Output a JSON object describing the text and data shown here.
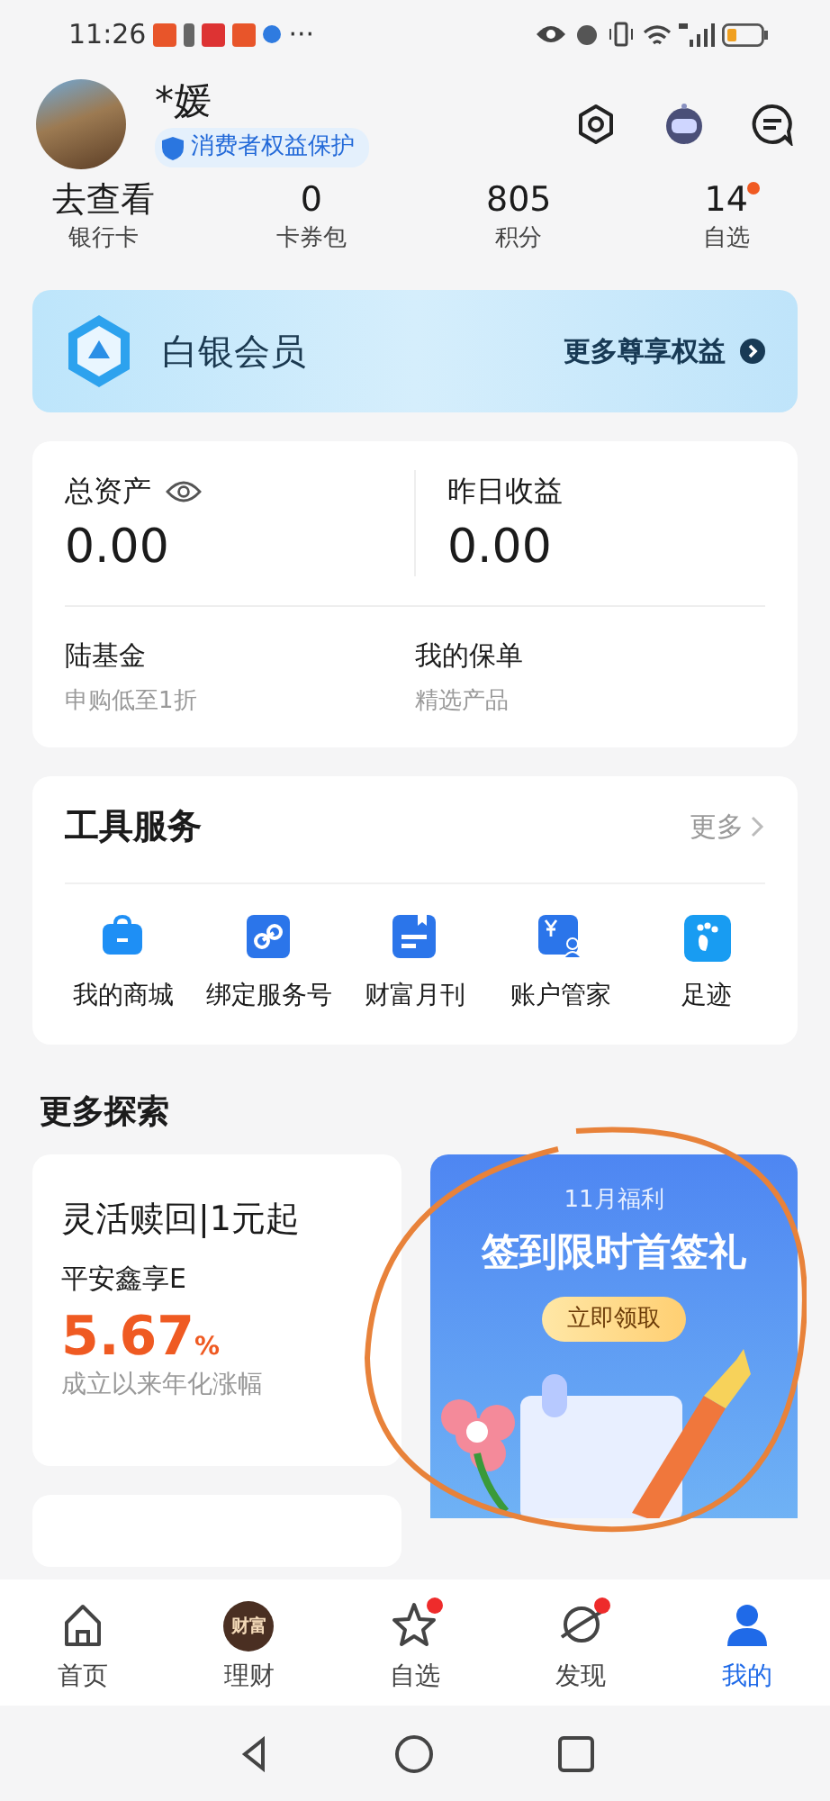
{
  "status_bar": {
    "time": "11:26",
    "more": "···"
  },
  "profile": {
    "name": "*媛",
    "badge": "消费者权益保护"
  },
  "stats": [
    {
      "value": "去查看",
      "label": "银行卡",
      "dot": false
    },
    {
      "value": "0",
      "label": "卡券包",
      "dot": false
    },
    {
      "value": "805",
      "label": "积分",
      "dot": false
    },
    {
      "value": "14",
      "label": "自选",
      "dot": true
    }
  ],
  "member": {
    "tier": "白银会员",
    "link": "更多尊享权益"
  },
  "assets": {
    "items": [
      {
        "label": "总资产",
        "value": "0.00"
      },
      {
        "label": "昨日收益",
        "value": "0.00"
      }
    ],
    "links": [
      {
        "title": "陆基金",
        "subtitle": "申购低至1折"
      },
      {
        "title": "我的保单",
        "subtitle": "精选产品"
      }
    ]
  },
  "tools": {
    "title": "工具服务",
    "more": "更多",
    "items": [
      {
        "label": "我的商城"
      },
      {
        "label": "绑定服务号"
      },
      {
        "label": "财富月刊"
      },
      {
        "label": "账户管家"
      },
      {
        "label": "足迹"
      }
    ]
  },
  "explore": {
    "title": "更多探索",
    "product": {
      "title": "灵活赎回|1元起",
      "name": "平安鑫享E",
      "rate": "5.67",
      "unit": "%",
      "caption": "成立以来年化涨幅"
    },
    "promo": {
      "eyebrow": "11月福利",
      "headline": "签到限时首签礼",
      "button": "立即领取"
    }
  },
  "bottom_nav": [
    {
      "label": "首页",
      "selected": false,
      "badge": false
    },
    {
      "label": "理财",
      "icon_text": "财富",
      "selected": false,
      "badge": false
    },
    {
      "label": "自选",
      "selected": false,
      "badge": true
    },
    {
      "label": "发现",
      "selected": false,
      "badge": true
    },
    {
      "label": "我的",
      "selected": true,
      "badge": false
    }
  ]
}
